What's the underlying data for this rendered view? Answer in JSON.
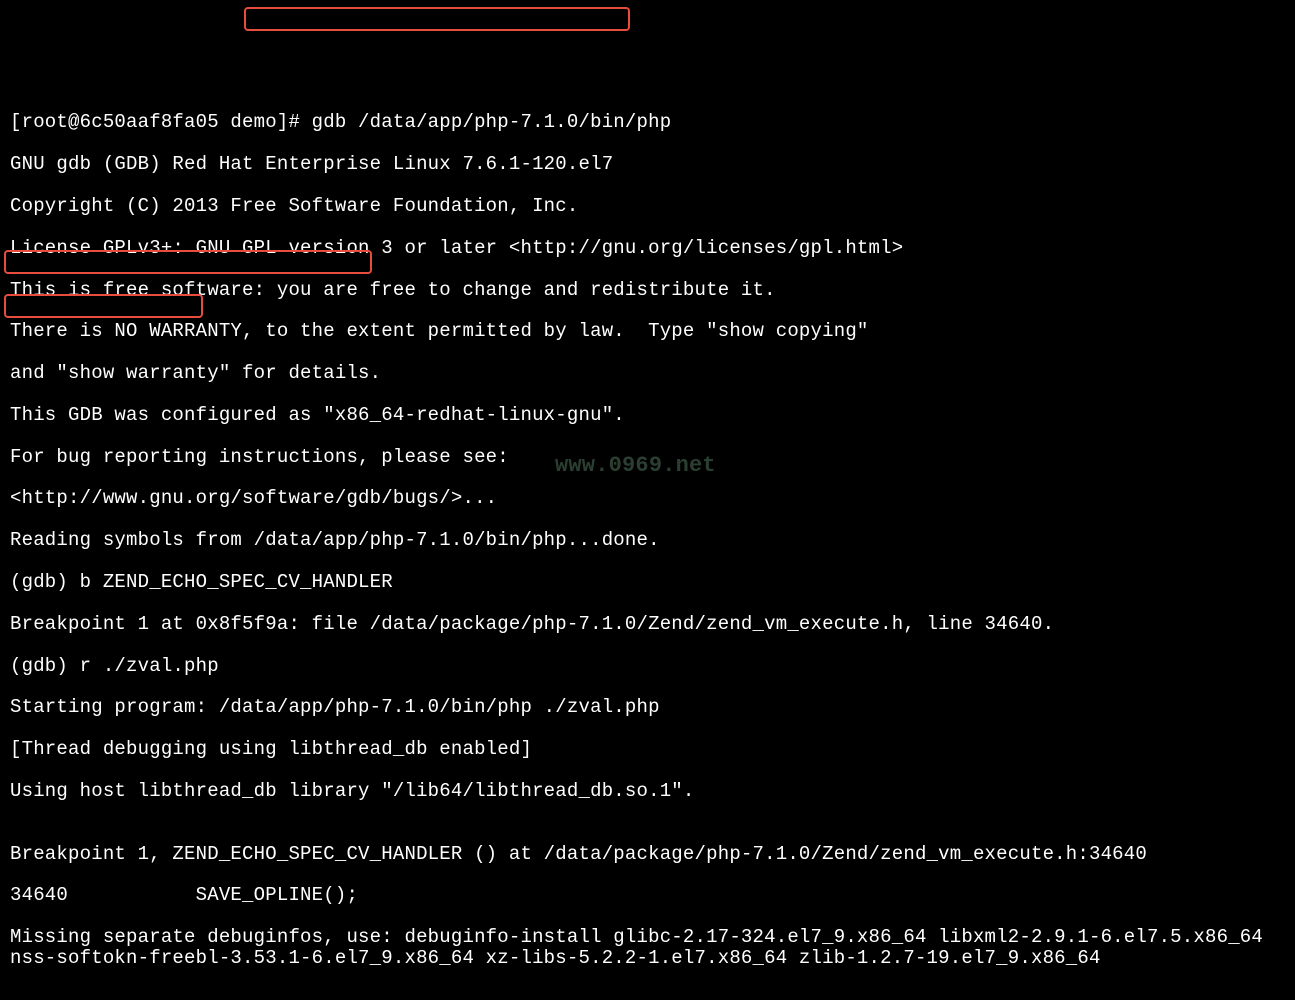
{
  "terminal": {
    "lines": [
      "[root@6c50aaf8fa05 demo]# gdb /data/app/php-7.1.0/bin/php",
      "GNU gdb (GDB) Red Hat Enterprise Linux 7.6.1-120.el7",
      "Copyright (C) 2013 Free Software Foundation, Inc.",
      "License GPLv3+: GNU GPL version 3 or later <http://gnu.org/licenses/gpl.html>",
      "This is free software: you are free to change and redistribute it.",
      "There is NO WARRANTY, to the extent permitted by law.  Type \"show copying\"",
      "and \"show warranty\" for details.",
      "This GDB was configured as \"x86_64-redhat-linux-gnu\".",
      "For bug reporting instructions, please see:",
      "<http://www.gnu.org/software/gdb/bugs/>...",
      "Reading symbols from /data/app/php-7.1.0/bin/php...done.",
      "(gdb) b ZEND_ECHO_SPEC_CV_HANDLER",
      "Breakpoint 1 at 0x8f5f9a: file /data/package/php-7.1.0/Zend/zend_vm_execute.h, line 34640.",
      "(gdb) r ./zval.php",
      "Starting program: /data/app/php-7.1.0/bin/php ./zval.php",
      "[Thread debugging using libthread_db enabled]",
      "Using host libthread_db library \"/lib64/libthread_db.so.1\".",
      "",
      "Breakpoint 1, ZEND_ECHO_SPEC_CV_HANDLER () at /data/package/php-7.1.0/Zend/zend_vm_execute.h:34640",
      "34640           SAVE_OPLINE();",
      "Missing separate debuginfos, use: debuginfo-install glibc-2.17-324.el7_9.x86_64 libxml2-2.9.1-6.el7.5.x86_64 nss-softokn-freebl-3.53.1-6.el7_9.x86_64 xz-libs-5.2.2-1.el7.x86_64 zlib-1.2.7-19.el7_9.x86_64"
    ]
  },
  "highlights": {
    "cmd1": "gdb /data/app/php-7.1.0/bin/php",
    "cmd2": "(gdb) b ZEND_ECHO_SPEC_CV_HANDLER",
    "cmd3": "(gdb) r ./zval.php"
  },
  "watermark": "www.0969.net"
}
